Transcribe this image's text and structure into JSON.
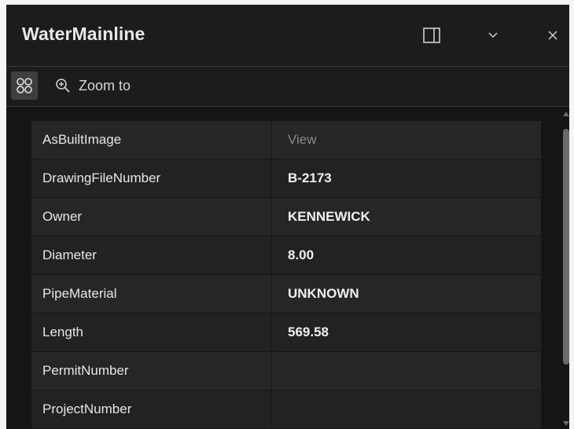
{
  "header": {
    "title": "WaterMainline",
    "dock_icon": "dock-panel-icon",
    "collapse_icon": "chevron-down-icon",
    "close_icon": "close-icon"
  },
  "toolbar": {
    "options_icon": "grid-options-icon",
    "zoom_icon": "zoom-in-icon",
    "zoom_label": "Zoom to"
  },
  "attributes": [
    {
      "key": "AsBuiltImage",
      "value": "View"
    },
    {
      "key": "DrawingFileNumber",
      "value": "B-2173"
    },
    {
      "key": "Owner",
      "value": "KENNEWICK"
    },
    {
      "key": "Diameter",
      "value": "8.00"
    },
    {
      "key": "PipeMaterial",
      "value": "UNKNOWN"
    },
    {
      "key": "Length",
      "value": "569.58"
    },
    {
      "key": "PermitNumber",
      "value": ""
    },
    {
      "key": "ProjectNumber",
      "value": ""
    }
  ],
  "colors": {
    "panel_bg": "#1c1c1c",
    "row_odd": "#262626",
    "row_even": "#222222",
    "text": "#e6e6e6",
    "link_text": "#8a8a8a"
  }
}
